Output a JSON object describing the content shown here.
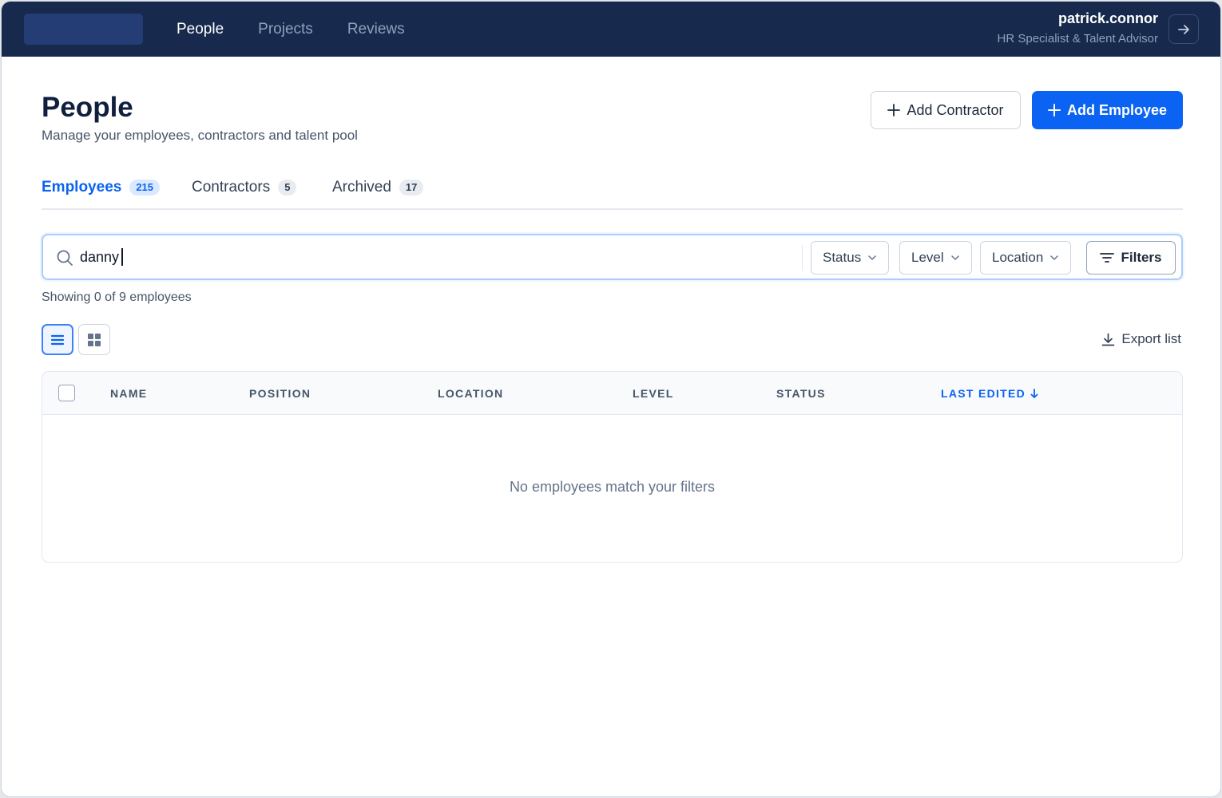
{
  "topbar": {
    "nav": [
      {
        "label": "People",
        "active": true
      },
      {
        "label": "Projects",
        "active": false
      },
      {
        "label": "Reviews",
        "active": false
      }
    ],
    "user": {
      "name": "patrick.connor",
      "role": "HR Specialist & Talent Advisor"
    },
    "logout_icon": "arrow-right-icon",
    "colors": {
      "bg": "#172a4d",
      "logo_placeholder": "#243d75"
    }
  },
  "header": {
    "title": "People",
    "subtitle": "Manage your employees, contractors and talent pool",
    "add_contractor_label": "Add Contractor",
    "add_employee_label": "Add Employee"
  },
  "tabs": [
    {
      "label": "Employees",
      "count": "215",
      "active": true
    },
    {
      "label": "Contractors",
      "count": "5",
      "active": false
    },
    {
      "label": "Archived",
      "count": "17",
      "active": false
    }
  ],
  "search": {
    "value": "danny",
    "icon": "search-icon"
  },
  "filters": {
    "status_label": "Status",
    "level_label": "Level",
    "location_label": "Location",
    "filters_label": "Filters"
  },
  "results": {
    "showing_text": "Showing 0 of 9 employees"
  },
  "view": {
    "mode": "list"
  },
  "export_label": "Export list",
  "table": {
    "columns": [
      "NAME",
      "POSITION",
      "LOCATION",
      "LEVEL",
      "STATUS",
      "LAST EDITED"
    ],
    "sorted_column": "LAST EDITED",
    "sort_direction": "desc",
    "empty_message": "No employees match your filters"
  },
  "colors": {
    "accent": "#0b63f3",
    "text_dark": "#0f1f3d"
  }
}
